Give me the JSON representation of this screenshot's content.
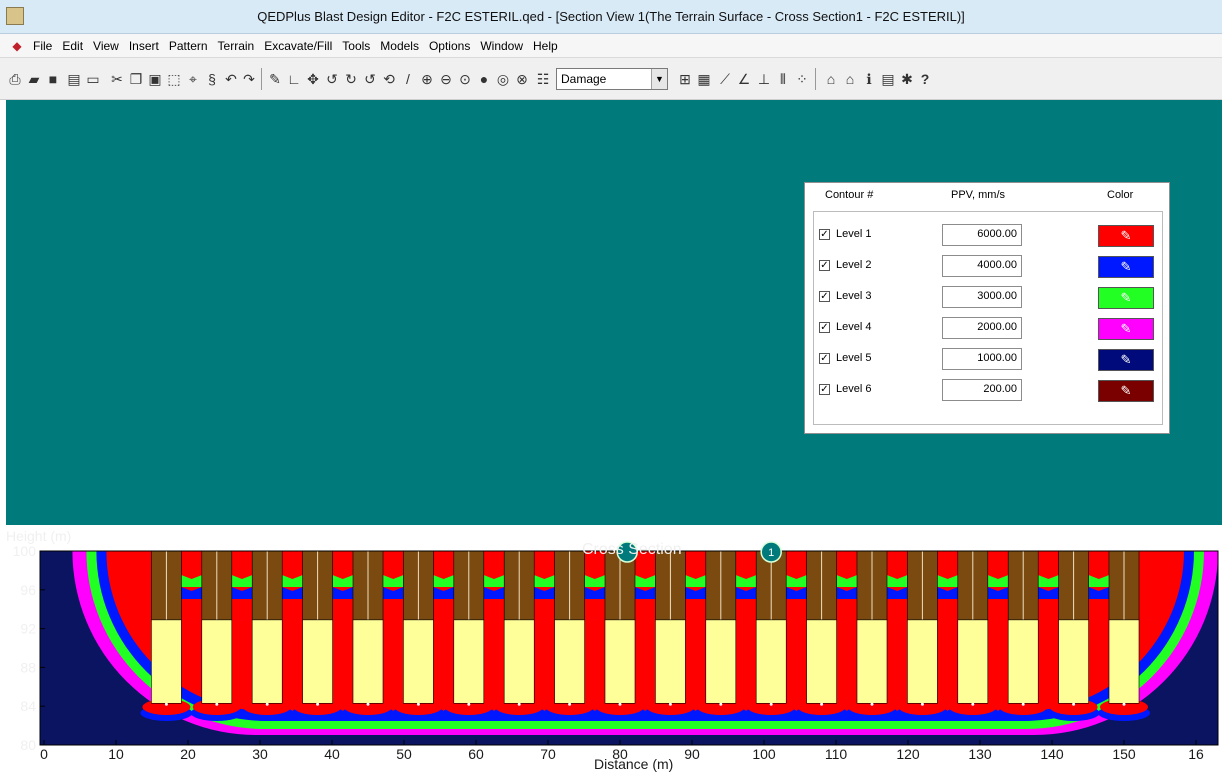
{
  "window": {
    "title": "QEDPlus Blast Design Editor - F2C ESTERIL.qed - [Section View 1(The Terrain Surface - Cross Section1 - F2C ESTERIL)]"
  },
  "menu": [
    "File",
    "Edit",
    "View",
    "Insert",
    "Pattern",
    "Terrain",
    "Excavate/Fill",
    "Tools",
    "Models",
    "Options",
    "Window",
    "Help"
  ],
  "toolbar": {
    "view_select": "Damage",
    "help_label": "?"
  },
  "contour_panel": {
    "headers": {
      "contour": "Contour #",
      "ppv": "PPV, mm/s",
      "color": "Color"
    },
    "rows": [
      {
        "checked": true,
        "label": "Level 1",
        "ppv": "6000.00",
        "color": "#ff0000"
      },
      {
        "checked": true,
        "label": "Level 2",
        "ppv": "4000.00",
        "color": "#0018ff"
      },
      {
        "checked": true,
        "label": "Level 3",
        "ppv": "3000.00",
        "color": "#22ff22"
      },
      {
        "checked": true,
        "label": "Level 4",
        "ppv": "2000.00",
        "color": "#ff00ff"
      },
      {
        "checked": true,
        "label": "Level 5",
        "ppv": "1000.00",
        "color": "#000a7a"
      },
      {
        "checked": true,
        "label": "Level 6",
        "ppv": "200.00",
        "color": "#7a0000"
      }
    ]
  },
  "chart_data": {
    "type": "heatmap",
    "title": "Cross Section",
    "xlabel": "Distance (m)",
    "ylabel": "Height (m)",
    "xlim": [
      0,
      160
    ],
    "ylim": [
      80,
      100
    ],
    "x_ticks": [
      0,
      10,
      20,
      30,
      40,
      50,
      60,
      70,
      80,
      90,
      100,
      110,
      120,
      130,
      140,
      150,
      "16"
    ],
    "y_ticks": [
      100,
      96,
      92,
      88,
      84,
      80
    ],
    "hole_x": [
      17,
      24,
      31,
      38,
      45,
      52,
      59,
      66,
      73,
      80,
      87,
      94,
      101,
      108,
      115,
      122,
      129,
      136,
      143,
      150
    ],
    "stemming_top": 100,
    "stemming_bottom": 92.9,
    "charge_bottom": 84.3,
    "section_markers": [
      {
        "label": "",
        "x": 81,
        "y": 100
      },
      {
        "label": "1",
        "x": 101,
        "y": 100
      }
    ],
    "colors": {
      "background": "#0a1460",
      "level1": "#ff0000",
      "level2": "#0018ff",
      "level3": "#22ff22",
      "level4": "#ff00ff",
      "stemming": "#7a4a10",
      "charge": "#ffff99"
    }
  }
}
